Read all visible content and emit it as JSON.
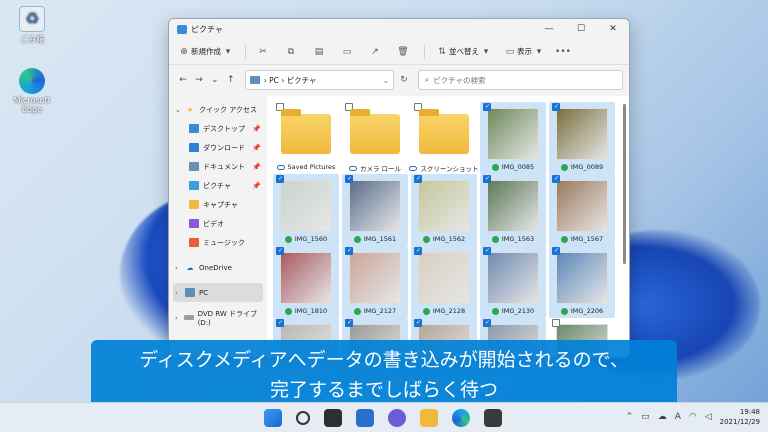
{
  "desktop": {
    "icons": [
      {
        "label": "ごみ箱"
      },
      {
        "label": "Microsoft Edge"
      }
    ]
  },
  "window": {
    "title": "ピクチャ",
    "controls": [
      "—",
      "☐",
      "✕"
    ]
  },
  "toolbar": {
    "new_label": "新規作成",
    "sort_label": "並べ替え",
    "view_label": "表示",
    "more_label": "•••"
  },
  "navbar": {
    "path": [
      "PC",
      "ピクチャ"
    ],
    "search_placeholder": "ピクチャの検索"
  },
  "sidebar": {
    "quick_access": "クイック アクセス",
    "items": [
      {
        "label": "デスクトップ",
        "pinned": true,
        "color": "#3b8ad8"
      },
      {
        "label": "ダウンロード",
        "pinned": true,
        "color": "#2f7fd6"
      },
      {
        "label": "ドキュメント",
        "pinned": true,
        "color": "#6f8fb0"
      },
      {
        "label": "ピクチャ",
        "pinned": true,
        "color": "#3e9de0"
      },
      {
        "label": "キャプチャ",
        "pinned": false,
        "color": "#f0b93b"
      },
      {
        "label": "ビデオ",
        "pinned": false,
        "color": "#8a5ad6"
      },
      {
        "label": "ミュージック",
        "pinned": false,
        "color": "#e5603a"
      }
    ],
    "onedrive": "OneDrive",
    "pc": "PC",
    "dvd": "DVD RW ドライブ (D:)"
  },
  "files": [
    {
      "name": "Saved Pictures",
      "kind": "folder",
      "status": "cloud",
      "selected": false
    },
    {
      "name": "カメラ ロール",
      "kind": "folder",
      "status": "cloud",
      "selected": false
    },
    {
      "name": "スクリーンショット",
      "kind": "folder",
      "status": "cloud",
      "selected": false
    },
    {
      "name": "IMG_0085",
      "kind": "photo",
      "status": "ok",
      "selected": true,
      "color": "#6d8a5c"
    },
    {
      "name": "IMG_0089",
      "kind": "photo",
      "status": "ok",
      "selected": true,
      "color": "#7a7040"
    },
    {
      "name": "IMG_1560",
      "kind": "photo",
      "status": "ok",
      "selected": true,
      "color": "#c9d4d0"
    },
    {
      "name": "IMG_1561",
      "kind": "photo",
      "status": "ok",
      "selected": true,
      "color": "#5a6f8a"
    },
    {
      "name": "IMG_1562",
      "kind": "photo",
      "status": "ok",
      "selected": true,
      "color": "#c4c89a"
    },
    {
      "name": "IMG_1563",
      "kind": "photo",
      "status": "ok",
      "selected": true,
      "color": "#5b7a58"
    },
    {
      "name": "IMG_1567",
      "kind": "photo",
      "status": "ok",
      "selected": true,
      "color": "#9a7a5c"
    },
    {
      "name": "IMG_1810",
      "kind": "photo",
      "status": "ok",
      "selected": true,
      "color": "#a85a62"
    },
    {
      "name": "IMG_2127",
      "kind": "photo",
      "status": "ok",
      "selected": true,
      "color": "#caa69a"
    },
    {
      "name": "IMG_2128",
      "kind": "photo",
      "status": "ok",
      "selected": true,
      "color": "#d8cfc0"
    },
    {
      "name": "IMG_2130",
      "kind": "photo",
      "status": "ok",
      "selected": true,
      "color": "#6f8ab0"
    },
    {
      "name": "IMG_2206",
      "kind": "photo",
      "status": "ok",
      "selected": true,
      "color": "#5a88b8"
    },
    {
      "name": "",
      "kind": "photo",
      "status": "",
      "selected": true,
      "color": "#b8b8b8"
    },
    {
      "name": "",
      "kind": "photo",
      "status": "",
      "selected": true,
      "color": "#9a9a9a"
    },
    {
      "name": "",
      "kind": "photo",
      "status": "",
      "selected": true,
      "color": "#b0a89a"
    },
    {
      "name": "",
      "kind": "photo",
      "status": "",
      "selected": true,
      "color": "#8a9aaa"
    },
    {
      "name": "",
      "kind": "photo",
      "status": "",
      "selected": false,
      "color": "#6a8a6a"
    }
  ],
  "subtitle": {
    "line1": "ディスクメディアへデータの書き込みが開始されるので、",
    "line2": "完了するまでしばらく待つ"
  },
  "taskbar": {
    "tray_ime": "A",
    "time": "19:48",
    "date": "2021/12/29"
  }
}
